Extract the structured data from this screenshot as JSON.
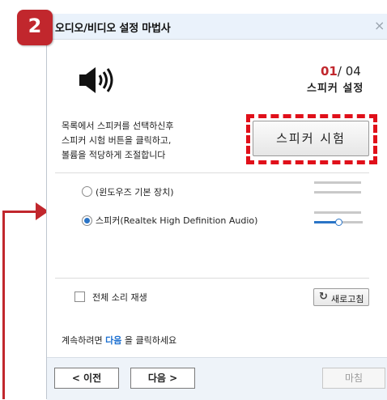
{
  "badge": {
    "step": "2"
  },
  "window": {
    "title": "오디오/비디오 설정 마법사",
    "close": "×"
  },
  "header": {
    "icon": "speaker-icon",
    "page_current": "01",
    "page_total": "/ 04",
    "section_title": "스피커 설정"
  },
  "instructions": {
    "line1": "목록에서 스피커를 선택하신후",
    "line2": "스피커 시험 버튼을 클릭하고,",
    "line3": "볼륨을 적당하게 조절합니다"
  },
  "test_button": {
    "label": "스피커 시험"
  },
  "devices": [
    {
      "label": "(윈도우즈 기본 장치)",
      "selected": false
    },
    {
      "label": "스피커(Realtek High Definition Audio)",
      "selected": true,
      "volume": 0.5
    }
  ],
  "options": {
    "all_sound_label": "전체 소리 재생",
    "refresh_label": "새로고침",
    "refresh_icon": "refresh-icon"
  },
  "continue": {
    "prefix": "계속하려면 ",
    "highlight": "다음",
    "suffix": " 을 클릭하세요"
  },
  "footer": {
    "prev_label": "< 이전",
    "next_label": "다음 >",
    "finish_label": "마침"
  },
  "colors": {
    "accent_red": "#c1272d",
    "dash_red": "#e0101a",
    "link_blue": "#1b6fd0",
    "slider_blue": "#2a74c6"
  }
}
